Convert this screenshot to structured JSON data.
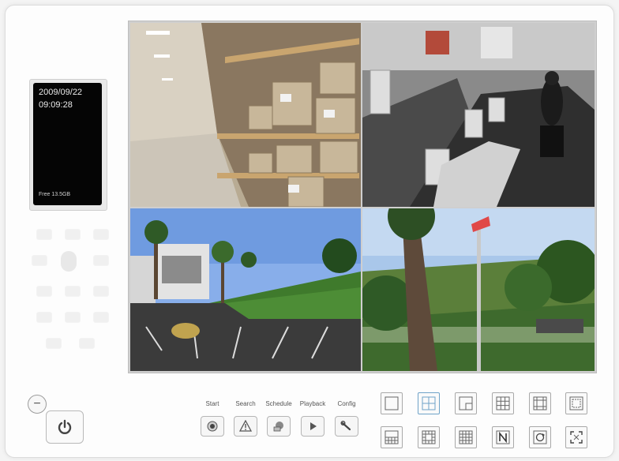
{
  "status_display": {
    "date": "2009/09/22",
    "time": "09:09:28",
    "free_space": "Free 13.5GB"
  },
  "cameras": [
    {
      "name": "camera-warehouse"
    },
    {
      "name": "camera-office"
    },
    {
      "name": "camera-parking-lot"
    },
    {
      "name": "camera-outdoor-trees"
    }
  ],
  "toolbar": {
    "start_label": "Start",
    "search_label": "Search",
    "schedule_label": "Schedule",
    "playback_label": "Playback",
    "config_label": "Config"
  },
  "layouts": {
    "active_index": 1,
    "icons": [
      "single-view-icon",
      "quad-view-icon",
      "pip-view-icon",
      "nine-grid-icon",
      "six-view-icon",
      "eight-view-icon",
      "grid-10-icon",
      "grid-13-icon",
      "grid-16-icon",
      "n-view-icon",
      "sequence-icon",
      "fullscreen-icon"
    ]
  },
  "colors": {
    "accent": "#6fa3c8",
    "screen_bg": "#050505"
  }
}
